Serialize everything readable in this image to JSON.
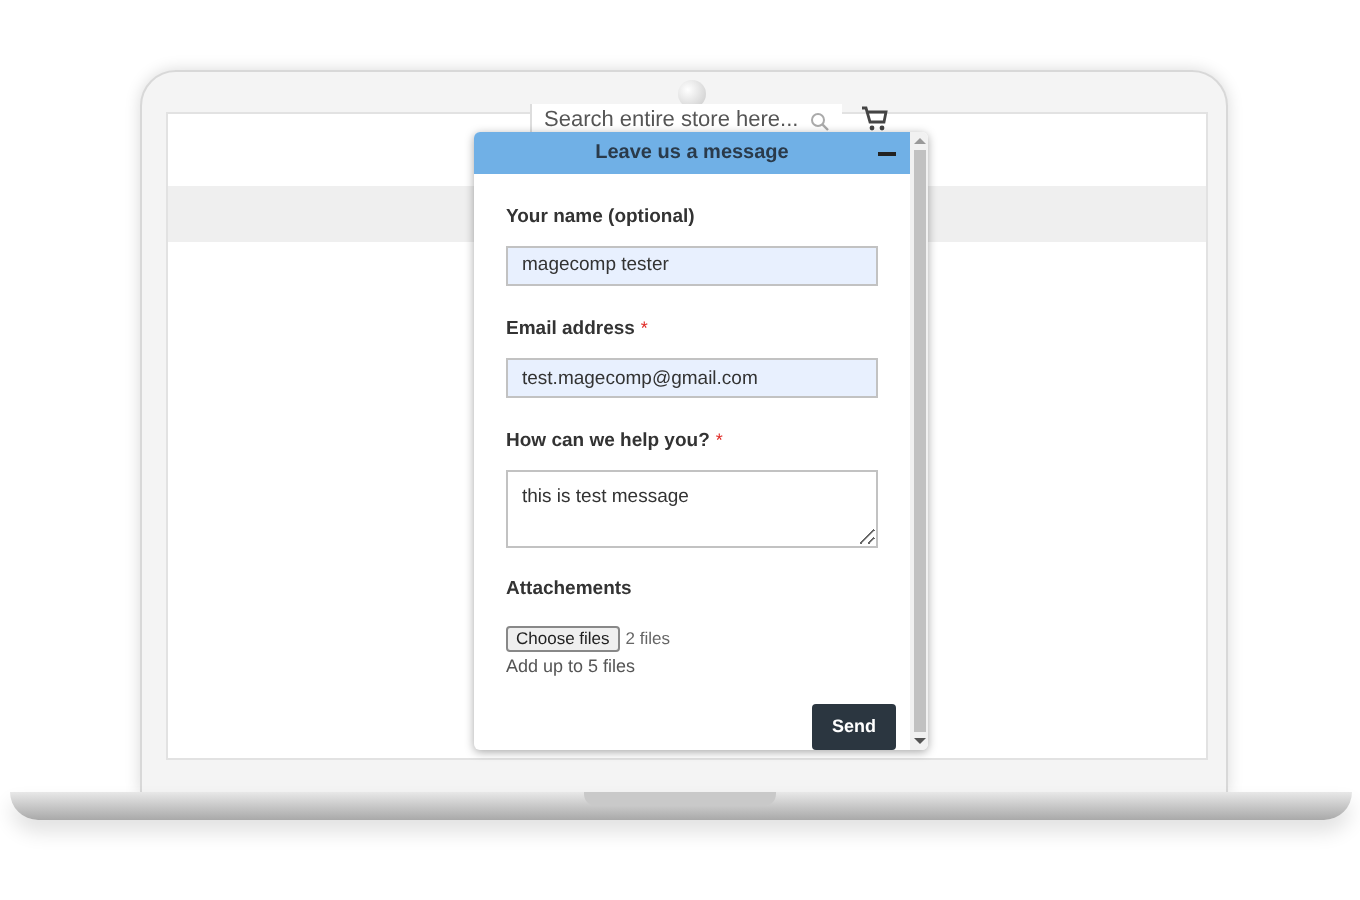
{
  "store": {
    "search": {
      "placeholder": "Search entire store here..."
    }
  },
  "dialog": {
    "title": "Leave us a message",
    "minimized": false,
    "fields": [
      {
        "kind": "input",
        "label": "Your name (optional)",
        "value": "magecomp tester"
      },
      {
        "kind": "input",
        "label": "Email address",
        "marker": "*",
        "value": "test.magecomp@gmail.com"
      },
      {
        "kind": "textarea",
        "label": "How can we help you?",
        "marker": "*",
        "value": "this is test message"
      }
    ],
    "attachments": {
      "label": "Attachements",
      "button": "Choose files",
      "status": "2 files",
      "hint": "Add up to 5 files"
    },
    "send": "Send"
  }
}
